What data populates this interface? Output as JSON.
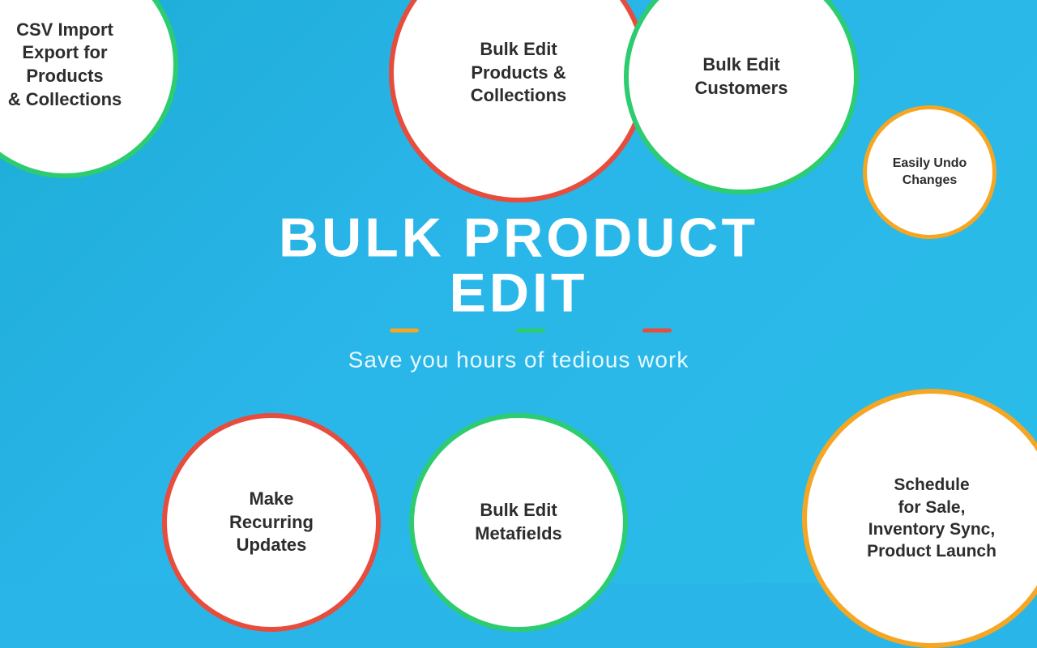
{
  "background_color": "#29b5e8",
  "center": {
    "title": "BULK PRODUCT EDIT",
    "subtitle": "Save you hours of tedious work"
  },
  "circles": {
    "csv": {
      "line1": "CSV Import",
      "line2": "Export for",
      "line3": "Products",
      "line4": "& Collections",
      "border_color": "#2ecc71"
    },
    "bulk_products": {
      "line1": "Bulk Edit",
      "line2": "Products &",
      "line3": "Collections",
      "border_color": "#e74c3c"
    },
    "customers": {
      "line1": "Bulk Edit",
      "line2": "Customers",
      "border_color": "#2ecc71"
    },
    "undo": {
      "line1": "Easily Undo",
      "line2": "Changes",
      "border_color": "#f5a623"
    },
    "recurring": {
      "line1": "Make",
      "line2": "Recurring",
      "line3": "Updates",
      "border_color": "#e74c3c"
    },
    "metafields": {
      "line1": "Bulk Edit",
      "line2": "Metafields",
      "border_color": "#2ecc71"
    },
    "schedule": {
      "line1": "Schedule",
      "line2": "for Sale,",
      "line3": "Inventory Sync,",
      "line4": "Product Launch",
      "border_color": "#f5a623"
    }
  },
  "title_underlines": {
    "color1": "#f5a623",
    "color2": "#2ecc71",
    "color3": "#e74c3c"
  }
}
